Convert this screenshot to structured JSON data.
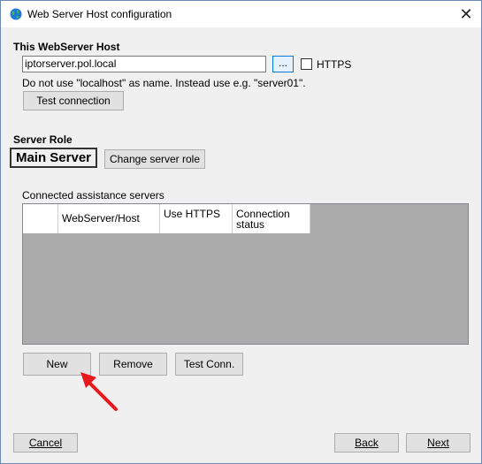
{
  "window": {
    "title": "Web Server Host configuration",
    "close_glyph": "✕"
  },
  "host_section": {
    "heading": "This WebServer Host",
    "host_value": "iptorserver.pol.local",
    "browse_label": "...",
    "https_label": "HTTPS",
    "https_checked": false,
    "hint": "Do not use \"localhost\" as name. Instead use e.g. \"server01\".",
    "test_connection_label": "Test connection"
  },
  "role_section": {
    "heading": "Server Role",
    "current_role": "Main Server",
    "change_role_label": "Change server role"
  },
  "assistance": {
    "heading": "Connected assistance servers",
    "columns": [
      "",
      "WebServer/Host",
      "Use HTTPS",
      "Connection status"
    ],
    "rows": []
  },
  "grid_buttons": {
    "new_label": "New",
    "remove_label": "Remove",
    "test_conn_label": "Test Conn."
  },
  "footer": {
    "cancel_label": "Cancel",
    "back_label": "Back",
    "next_label": "Next"
  },
  "annotation": {
    "arrow_color": "#e8191c",
    "points_to": "New"
  }
}
